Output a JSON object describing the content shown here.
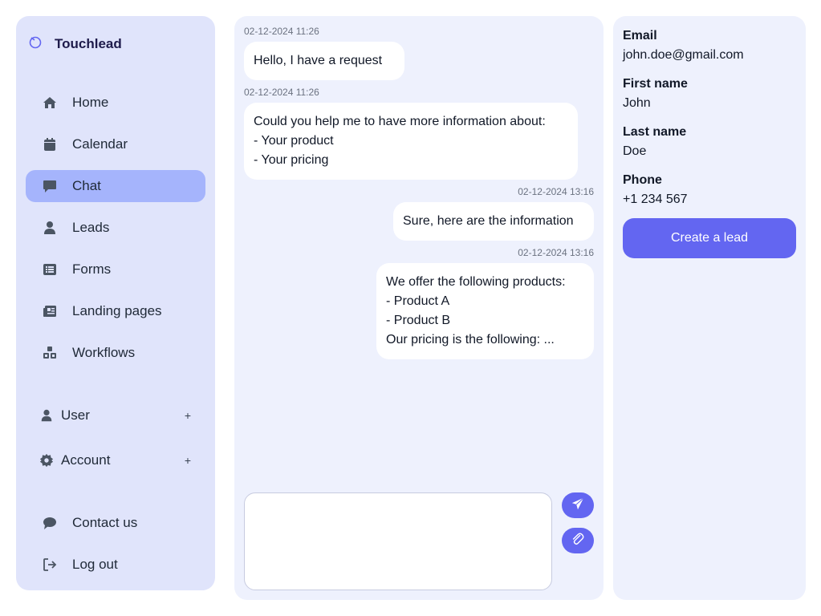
{
  "colors": {
    "accent": "#6366f1",
    "sidebar_bg": "#e0e4fb",
    "active_item": "#a5b4fc",
    "panel_bg": "#eef1fd",
    "icon": "#4b5563"
  },
  "brand": {
    "name": "Touchlead",
    "icon": "logo-icon"
  },
  "sidebar": {
    "nav": [
      {
        "label": "Home",
        "icon": "home-icon"
      },
      {
        "label": "Calendar",
        "icon": "calendar-icon"
      },
      {
        "label": "Chat",
        "icon": "chat-bubble-icon",
        "active": true
      },
      {
        "label": "Leads",
        "icon": "person-icon"
      },
      {
        "label": "Forms",
        "icon": "list-icon"
      },
      {
        "label": "Landing pages",
        "icon": "newspaper-icon"
      },
      {
        "label": "Workflows",
        "icon": "cubes-icon"
      }
    ],
    "groups": [
      {
        "label": "User",
        "icon": "person-icon",
        "expand": "+"
      },
      {
        "label": "Account",
        "icon": "gear-icon",
        "expand": "+"
      }
    ],
    "footer": [
      {
        "label": "Contact us",
        "icon": "speech-icon"
      },
      {
        "label": "Log out",
        "icon": "logout-icon"
      }
    ]
  },
  "chat": {
    "messages": [
      {
        "time": "02-12-2024 11:26",
        "lines": [
          "Hello, I have a request"
        ],
        "side": "left"
      },
      {
        "time": "02-12-2024 11:26",
        "lines": [
          "Could you help me to have more information about:",
          "- Your product",
          "- Your pricing"
        ],
        "side": "left"
      },
      {
        "time": "02-12-2024 13:16",
        "lines": [
          "Sure, here are the information"
        ],
        "side": "right"
      },
      {
        "time": "02-12-2024 13:16",
        "lines": [
          "We offer the following products:",
          "- Product A",
          "- Product B",
          "Our pricing is the following: ..."
        ],
        "side": "right"
      }
    ],
    "composer": {
      "value": "",
      "placeholder": ""
    },
    "send_icon": "send-icon",
    "attach_icon": "paperclip-icon"
  },
  "lead": {
    "email_label": "Email",
    "email": "john.doe@gmail.com",
    "first_name_label": "First name",
    "first_name": "John",
    "last_name_label": "Last name",
    "last_name": "Doe",
    "phone_label": "Phone",
    "phone": "+1 234 567",
    "create_label": "Create a lead"
  }
}
